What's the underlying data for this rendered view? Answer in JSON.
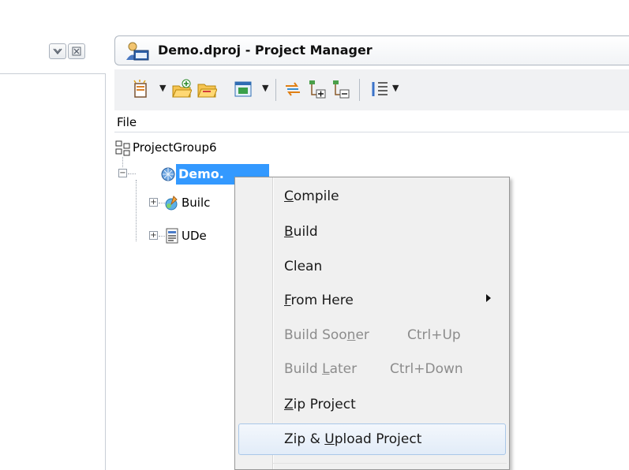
{
  "window": {
    "title": "Demo.dproj - Project Manager",
    "controls": [
      "restore-icon",
      "close-icon"
    ]
  },
  "toolbar": {
    "icons": [
      "new-item-icon",
      "add-new-project-icon",
      "add-existing-project-icon",
      "build-configurations-icon",
      "sync-icon",
      "expand-all-icon",
      "collapse-all-icon",
      "sort-options-icon"
    ]
  },
  "columns": {
    "file": "File"
  },
  "tree": {
    "group": "ProjectGroup6",
    "project": "Demo.",
    "children": [
      "Builc",
      "UDe"
    ]
  },
  "context_menu": {
    "items": [
      {
        "label_u": "C",
        "label_rest": "ompile",
        "label_pre": ""
      },
      {
        "label_u": "B",
        "label_rest": "uild",
        "label_pre": ""
      },
      {
        "label_pre": "Clean",
        "label_u": "",
        "label_rest": ""
      },
      {
        "label_u": "F",
        "label_rest": "rom Here",
        "label_pre": ""
      },
      {
        "label_pre": "Build Soo",
        "label_u": "n",
        "label_rest": "er",
        "shortcut": "Ctrl+Up"
      },
      {
        "label_pre": "Build ",
        "label_u": "L",
        "label_rest": "ater",
        "shortcut": "Ctrl+Down"
      },
      {
        "label_u": "Z",
        "label_rest": "ip Project",
        "label_pre": ""
      },
      {
        "label_pre": "Zip & ",
        "label_u": "U",
        "label_rest": "pload Project"
      }
    ]
  },
  "colors": {
    "selection": "#3399ff",
    "menu_background": "#f0f0f0",
    "disabled_text": "#8c8c8c"
  }
}
